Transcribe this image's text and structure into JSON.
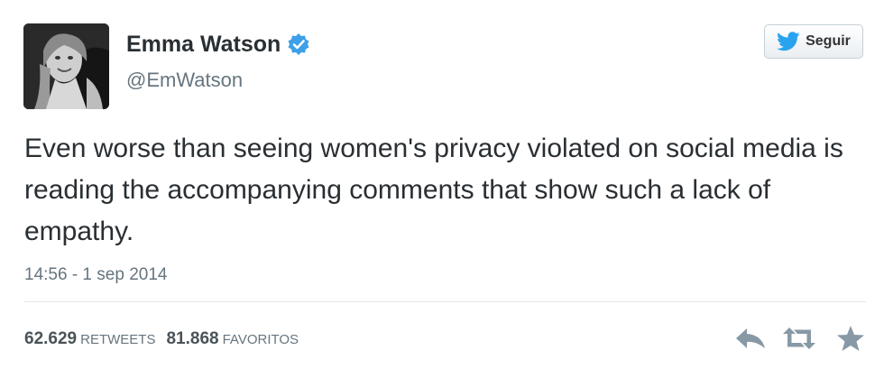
{
  "author": {
    "name": "Emma Watson",
    "handle": "@EmWatson",
    "verified": true
  },
  "follow_button": {
    "label": "Seguir",
    "icon": "twitter-bird-icon"
  },
  "tweet": {
    "text": "Even worse than seeing women's privacy violated on social media is reading the accompanying comments that show such a lack of empathy.",
    "timestamp": "14:56 - 1 sep 2014"
  },
  "stats": {
    "retweets_count": "62.629",
    "retweets_label": "RETWEETS",
    "favorites_count": "81.868",
    "favorites_label": "FAVORITOS"
  },
  "actions": [
    {
      "name": "reply",
      "icon": "reply-arrow-icon"
    },
    {
      "name": "retweet",
      "icon": "retweet-icon"
    },
    {
      "name": "favorite",
      "icon": "star-icon"
    }
  ],
  "colors": {
    "verified_blue": "#3ea0e8",
    "twitter_blue": "#2aa3ef",
    "text": "#292f33",
    "muted": "#66757f",
    "action_icon": "#8899a6"
  }
}
